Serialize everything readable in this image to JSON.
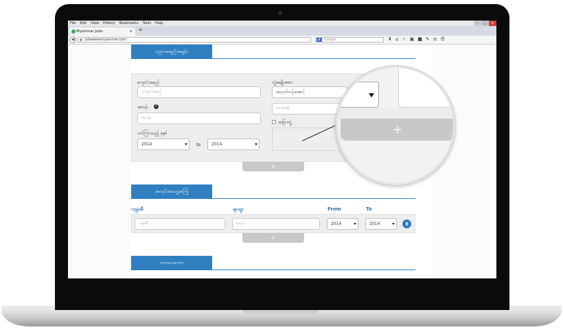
{
  "browser": {
    "menu": [
      "File",
      "Edit",
      "View",
      "History",
      "Bookmarks",
      "Tools",
      "Help"
    ],
    "tab_title": "Myanmar Jobs",
    "tab_close": "×",
    "new_tab": "+",
    "url": "jobseekermyanmar.com",
    "search_engine_badge": "8",
    "search_placeholder": "Google",
    "window_buttons": [
      "–",
      "□",
      "×"
    ]
  },
  "education": {
    "header": "ပညာအရည်အချင်း",
    "school_label": "ကျောင်းအမည်",
    "school_placeholder": "ကျောင်းအမည်",
    "degree_type_label": "ဘွဲ့အမျိုးအစား",
    "degree_type_value": "အသက်တန်းအောင်",
    "major_label": "အတန်း",
    "major_placeholder": "အတန်း",
    "major_detail_placeholder": "ဆယ်တန်း",
    "date_label": "သင်ကြားသည့် ခုနှစ်",
    "from_year": "2014",
    "to_label": "to",
    "to_year": "2014",
    "checkbox_label": "အခြားဘွဲ့",
    "add_label": "+"
  },
  "experience": {
    "header": "အလုပ်အတွေ့အကြုံ",
    "col_company": "ကုမ္ပဏီ",
    "col_position": "ရာထူး",
    "col_from": "From",
    "col_to": "To",
    "company_placeholder": "ကုမ္ပဏီ",
    "position_placeholder": "ရာထူး",
    "from_year": "2014",
    "to_year": "2014",
    "add_label": "+"
  },
  "language": {
    "header": "ဘာသာစကား"
  },
  "magnifier": {
    "add_label": "+"
  }
}
